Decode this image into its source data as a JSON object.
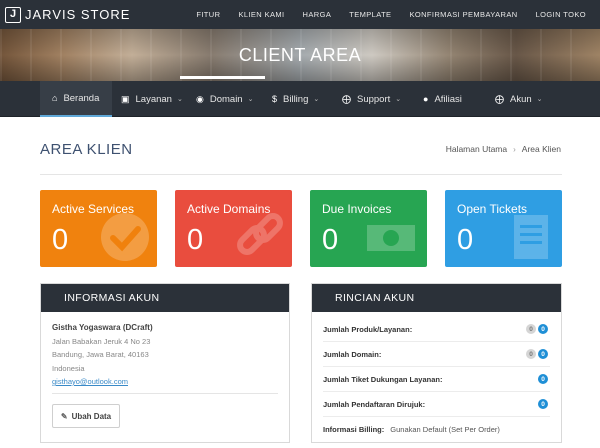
{
  "brand": {
    "mark": "J",
    "name": "JARVIS STORE"
  },
  "top_nav": [
    "FITUR",
    "KLIEN KAMI",
    "HARGA",
    "TEMPLATE",
    "KONFIRMASI PEMBAYARAN",
    "LOGIN TOKO"
  ],
  "hero": {
    "title": "CLIENT AREA"
  },
  "main_nav": [
    {
      "label": "Beranda",
      "icon": "home-icon"
    },
    {
      "label": "Layanan",
      "icon": "cube-icon"
    },
    {
      "label": "Domain",
      "icon": "globe-icon"
    },
    {
      "label": "Billing",
      "icon": "dollar-icon"
    },
    {
      "label": "Support",
      "icon": "lifebuoy-icon"
    },
    {
      "label": "Afiliasi",
      "icon": "user-icon"
    },
    {
      "label": "Akun",
      "icon": "account-icon"
    }
  ],
  "page": {
    "title": "AREA KLIEN",
    "breadcrumb": [
      "Halaman Utama",
      "Area Klien"
    ]
  },
  "tiles": [
    {
      "label": "Active Services",
      "count": "0",
      "color": "#f0820e",
      "icon": "check-icon"
    },
    {
      "label": "Active Domains",
      "count": "0",
      "color": "#e94d3e",
      "icon": "link-icon"
    },
    {
      "label": "Due Invoices",
      "count": "0",
      "color": "#27a552",
      "icon": "money-icon"
    },
    {
      "label": "Open Tickets",
      "count": "0",
      "color": "#2f9ee3",
      "icon": "ticket-icon"
    }
  ],
  "info_panel": {
    "title": "INFORMASI AKUN",
    "name": "Gistha Yogaswara (DCraft)",
    "address1": "Jalan Babakan Jeruk 4 No 23",
    "address2": "Bandung, Jawa Barat, 40163",
    "country": "Indonesia",
    "email": "gisthayo@outlook.com",
    "button": "Ubah Data"
  },
  "rincian_panel": {
    "title": "RINCIAN AKUN",
    "rows": [
      {
        "label": "Jumlah Produk/Layanan:",
        "grey": "0",
        "blue": "0"
      },
      {
        "label": "Jumlah Domain:",
        "grey": "0",
        "blue": "0"
      },
      {
        "label": "Jumlah Tiket Dukungan Layanan:",
        "blue": "0"
      },
      {
        "label": "Jumlah Pendaftaran Dirujuk:",
        "blue": "0"
      }
    ],
    "billing_label": "Informasi Billing:",
    "billing_value": "Gunakan Default (Set Per Order)"
  },
  "colors": {
    "dark": "#2b3139",
    "accent": "#5fa8d8",
    "title": "#3e5170"
  }
}
